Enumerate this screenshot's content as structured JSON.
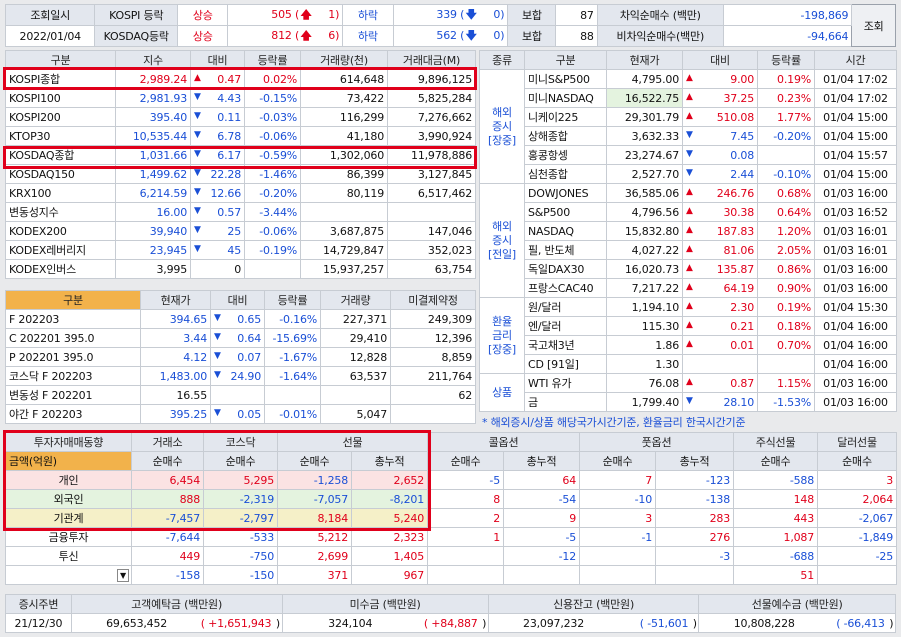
{
  "top": {
    "l1": "조회일시",
    "date": "2022/01/04",
    "kospi_label": "KOSPI 등락",
    "kosdaq_label": "KOSDAQ등락",
    "up": "상승",
    "down": "하락",
    "flat": "보합",
    "kospi_up": "505",
    "kospi_up2": "1",
    "kospi_dn": "339",
    "kospi_dn2": "0",
    "kospi_flat": "87",
    "kosdaq_up": "812",
    "kosdaq_up2": "6",
    "kosdaq_dn": "562",
    "kosdaq_dn2": "0",
    "kosdaq_flat": "88",
    "arb_label": "차익순매수 (백만)",
    "arb_val": "-198,869",
    "narb_label": "비차익순매수(백만)",
    "narb_val": "-94,664",
    "query_btn": "조회"
  },
  "idx": {
    "headers": [
      "구분",
      "지수",
      "대비",
      "등락률",
      "거래량(천)",
      "거래대금(M)"
    ],
    "rows": [
      {
        "n": "KOSPI종합",
        "v": "2,989.24",
        "s": "▲",
        "sc": "red",
        "d": "0.47",
        "dc": "red",
        "r": "0.02%",
        "rc": "red",
        "vol": "614,648",
        "amt": "9,896,125"
      },
      {
        "n": "KOSPI100",
        "v": "2,981.93",
        "s": "▼",
        "sc": "blue",
        "d": "4.43",
        "dc": "blue",
        "r": "-0.15%",
        "rc": "blue",
        "vol": "73,422",
        "amt": "5,825,284"
      },
      {
        "n": "KOSPI200",
        "v": "395.40",
        "s": "▼",
        "sc": "blue",
        "d": "0.11",
        "dc": "blue",
        "r": "-0.03%",
        "rc": "blue",
        "vol": "116,299",
        "amt": "7,276,662"
      },
      {
        "n": "KTOP30",
        "v": "10,535.44",
        "s": "▼",
        "sc": "blue",
        "d": "6.78",
        "dc": "blue",
        "r": "-0.06%",
        "rc": "blue",
        "vol": "41,180",
        "amt": "3,990,924"
      },
      {
        "n": "KOSDAQ종합",
        "v": "1,031.66",
        "s": "▼",
        "sc": "blue",
        "d": "6.17",
        "dc": "blue",
        "r": "-0.59%",
        "rc": "blue",
        "vol": "1,302,060",
        "amt": "11,978,886"
      },
      {
        "n": "KOSDAQ150",
        "v": "1,499.62",
        "s": "▼",
        "sc": "blue",
        "d": "22.28",
        "dc": "blue",
        "r": "-1.46%",
        "rc": "blue",
        "vol": "86,399",
        "amt": "3,127,845"
      },
      {
        "n": "KRX100",
        "v": "6,214.59",
        "s": "▼",
        "sc": "blue",
        "d": "12.66",
        "dc": "blue",
        "r": "-0.20%",
        "rc": "blue",
        "vol": "80,119",
        "amt": "6,517,462"
      },
      {
        "n": "변동성지수",
        "v": "16.00",
        "s": "▼",
        "sc": "blue",
        "d": "0.57",
        "dc": "blue",
        "r": "-3.44%",
        "rc": "blue",
        "vol": "",
        "amt": ""
      },
      {
        "n": "KODEX200",
        "v": "39,940",
        "s": "▼",
        "sc": "blue",
        "d": "25",
        "dc": "blue",
        "r": "-0.06%",
        "rc": "blue",
        "vol": "3,687,875",
        "amt": "147,046"
      },
      {
        "n": "KODEX레버리지",
        "v": "23,945",
        "s": "▼",
        "sc": "blue",
        "d": "45",
        "dc": "blue",
        "r": "-0.19%",
        "rc": "blue",
        "vol": "14,729,847",
        "amt": "352,023"
      },
      {
        "n": "KODEX인버스",
        "v": "3,995",
        "s": "",
        "sc": "",
        "d": "0",
        "dc": "",
        "r": "",
        "rc": "",
        "vol": "15,937,257",
        "amt": "63,754"
      }
    ]
  },
  "fut": {
    "headers": [
      "구분",
      "현재가",
      "대비",
      "등락률",
      "거래량",
      "미결제약정"
    ],
    "rows": [
      {
        "n": "F 202203",
        "v": "394.65",
        "s": "▼",
        "sc": "blue",
        "d": "0.65",
        "dc": "blue",
        "r": "-0.16%",
        "rc": "blue",
        "vol": "227,371",
        "oi": "249,309"
      },
      {
        "n": "C 202201 395.0",
        "v": "3.44",
        "s": "▼",
        "sc": "blue",
        "d": "0.64",
        "dc": "blue",
        "r": "-15.69%",
        "rc": "blue",
        "vol": "29,410",
        "oi": "12,396"
      },
      {
        "n": "P 202201 395.0",
        "v": "4.12",
        "s": "▼",
        "sc": "blue",
        "d": "0.07",
        "dc": "blue",
        "r": "-1.67%",
        "rc": "blue",
        "vol": "12,828",
        "oi": "8,859"
      },
      {
        "n": "코스닥 F 202203",
        "v": "1,483.00",
        "s": "▼",
        "sc": "blue",
        "d": "24.90",
        "dc": "blue",
        "r": "-1.64%",
        "rc": "blue",
        "vol": "63,537",
        "oi": "211,764"
      },
      {
        "n": "변동성 F 202201",
        "v": "16.55",
        "s": "",
        "sc": "",
        "d": "",
        "dc": "",
        "r": "",
        "rc": "",
        "vol": "",
        "oi": "62"
      },
      {
        "n": "야간 F 202203",
        "v": "395.25",
        "s": "▼",
        "sc": "blue",
        "d": "0.05",
        "dc": "blue",
        "r": "-0.01%",
        "rc": "blue",
        "vol": "5,047",
        "oi": ""
      }
    ]
  },
  "ovs": {
    "headers": [
      "종류",
      "구분",
      "현재가",
      "대비",
      "등락률",
      "시간"
    ],
    "groups": [
      {
        "label": "해외\n증시\n[장중]",
        "rows": [
          {
            "n": "미니S&P500",
            "v": "4,795.00",
            "s": "▲",
            "sc": "red",
            "d": "9.00",
            "dc": "red",
            "r": "0.19%",
            "rc": "red",
            "t": "01/04 17:02"
          },
          {
            "n": "미니NASDAQ",
            "v": "16,522.75",
            "s": "▲",
            "sc": "red",
            "d": "37.25",
            "dc": "red",
            "r": "0.23%",
            "rc": "red",
            "t": "01/04 17:02",
            "hl": true
          },
          {
            "n": "니케이225",
            "v": "29,301.79",
            "s": "▲",
            "sc": "red",
            "d": "510.08",
            "dc": "red",
            "r": "1.77%",
            "rc": "red",
            "t": "01/04 15:00"
          },
          {
            "n": "상해종합",
            "v": "3,632.33",
            "s": "▼",
            "sc": "blue",
            "d": "7.45",
            "dc": "blue",
            "r": "-0.20%",
            "rc": "blue",
            "t": "01/04 15:00"
          },
          {
            "n": "홍콩항셍",
            "v": "23,274.67",
            "s": "▼",
            "sc": "blue",
            "d": "0.08",
            "dc": "blue",
            "r": "",
            "rc": "",
            "t": "01/04 15:57"
          },
          {
            "n": "심천종합",
            "v": "2,527.70",
            "s": "▼",
            "sc": "blue",
            "d": "2.44",
            "dc": "blue",
            "r": "-0.10%",
            "rc": "blue",
            "t": "01/04 15:00"
          }
        ]
      },
      {
        "label": "해외\n증시\n[전일]",
        "rows": [
          {
            "n": "DOWJONES",
            "v": "36,585.06",
            "s": "▲",
            "sc": "red",
            "d": "246.76",
            "dc": "red",
            "r": "0.68%",
            "rc": "red",
            "t": "01/03 16:00"
          },
          {
            "n": "S&P500",
            "v": "4,796.56",
            "s": "▲",
            "sc": "red",
            "d": "30.38",
            "dc": "red",
            "r": "0.64%",
            "rc": "red",
            "t": "01/03 16:52"
          },
          {
            "n": "NASDAQ",
            "v": "15,832.80",
            "s": "▲",
            "sc": "red",
            "d": "187.83",
            "dc": "red",
            "r": "1.20%",
            "rc": "red",
            "t": "01/03 16:01"
          },
          {
            "n": "필, 반도체",
            "v": "4,027.22",
            "s": "▲",
            "sc": "red",
            "d": "81.06",
            "dc": "red",
            "r": "2.05%",
            "rc": "red",
            "t": "01/03 16:01"
          },
          {
            "n": "독일DAX30",
            "v": "16,020.73",
            "s": "▲",
            "sc": "red",
            "d": "135.87",
            "dc": "red",
            "r": "0.86%",
            "rc": "red",
            "t": "01/03 16:00"
          },
          {
            "n": "프랑스CAC40",
            "v": "7,217.22",
            "s": "▲",
            "sc": "red",
            "d": "64.19",
            "dc": "red",
            "r": "0.90%",
            "rc": "red",
            "t": "01/03 16:00"
          }
        ]
      },
      {
        "label": "환율\n금리\n[장중]",
        "rows": [
          {
            "n": "원/달러",
            "v": "1,194.10",
            "s": "▲",
            "sc": "red",
            "d": "2.30",
            "dc": "red",
            "r": "0.19%",
            "rc": "red",
            "t": "01/04 15:30"
          },
          {
            "n": "엔/달러",
            "v": "115.30",
            "s": "▲",
            "sc": "red",
            "d": "0.21",
            "dc": "red",
            "r": "0.18%",
            "rc": "red",
            "t": "01/04 16:00"
          },
          {
            "n": "국고채3년",
            "v": "1.86",
            "s": "▲",
            "sc": "red",
            "d": "0.01",
            "dc": "red",
            "r": "0.70%",
            "rc": "red",
            "t": "01/04 16:00"
          },
          {
            "n": "CD [91일]",
            "v": "1.30",
            "s": "",
            "sc": "",
            "d": "",
            "dc": "",
            "r": "",
            "rc": "",
            "t": "01/04 16:00"
          }
        ]
      },
      {
        "label": "상품",
        "rows": [
          {
            "n": "WTI 유가",
            "v": "76.08",
            "s": "▲",
            "sc": "red",
            "d": "0.87",
            "dc": "red",
            "r": "1.15%",
            "rc": "red",
            "t": "01/03 16:00"
          },
          {
            "n": "금",
            "v": "1,799.40",
            "s": "▼",
            "sc": "blue",
            "d": "28.10",
            "dc": "blue",
            "r": "-1.53%",
            "rc": "blue",
            "t": "01/03 16:00"
          }
        ]
      }
    ],
    "note": "* 해외증시/상품 해당국가시간기준, 환율금리 한국시간기준"
  },
  "inv": {
    "corner": "투자자매매동향",
    "h1": [
      "거래소",
      "코스닥",
      "선물",
      "콜옵션",
      "풋옵션",
      "주식선물",
      "달러선물"
    ],
    "amount_label": "금액(억원)",
    "h2": [
      "순매수",
      "순매수",
      "순매수",
      "총누적",
      "순매수",
      "총누적",
      "순매수",
      "총누적",
      "순매수",
      "순매수"
    ],
    "rows": [
      {
        "n": "개인",
        "cls": "pink",
        "v": [
          "6,454",
          "5,295",
          "-1,258",
          "2,652",
          "-5",
          "64",
          "7",
          "-123",
          "-588",
          "3"
        ]
      },
      {
        "n": "외국인",
        "cls": "green",
        "v": [
          "888",
          "-2,319",
          "-7,057",
          "-8,201",
          "8",
          "-54",
          "-10",
          "-138",
          "148",
          "2,064"
        ]
      },
      {
        "n": "기관계",
        "cls": "yel",
        "v": [
          "-7,457",
          "-2,797",
          "8,184",
          "5,240",
          "2",
          "9",
          "3",
          "283",
          "443",
          "-2,067"
        ]
      },
      {
        "n": "금융투자",
        "cls": "",
        "v": [
          "-7,644",
          "-533",
          "5,212",
          "2,323",
          "1",
          "-5",
          "-1",
          "276",
          "1,087",
          "-1,849"
        ]
      },
      {
        "n": "투신",
        "cls": "",
        "v": [
          "449",
          "-750",
          "2,699",
          "1,405",
          "",
          "-12",
          "",
          "-3",
          "-688",
          "-25"
        ]
      },
      {
        "n": "연기금등",
        "cls": "",
        "v": [
          "-158",
          "-150",
          "371",
          "967",
          "",
          "",
          "",
          "",
          "51",
          ""
        ]
      }
    ]
  },
  "bottom": {
    "headers": [
      "증시주변",
      "고객예탁금 (백만원)",
      "미수금 (백만원)",
      "신용잔고 (백만원)",
      "선물예수금 (백만원)"
    ],
    "date": "21/12/30",
    "dep": "69,653,452",
    "dep_chg": "+1,651,943",
    "unpaid": "324,104",
    "unpaid_chg": "+84,887",
    "credit": "23,097,232",
    "credit_chg": "-51,601",
    "fdep": "10,808,228",
    "fdep_chg": "-66,413"
  }
}
